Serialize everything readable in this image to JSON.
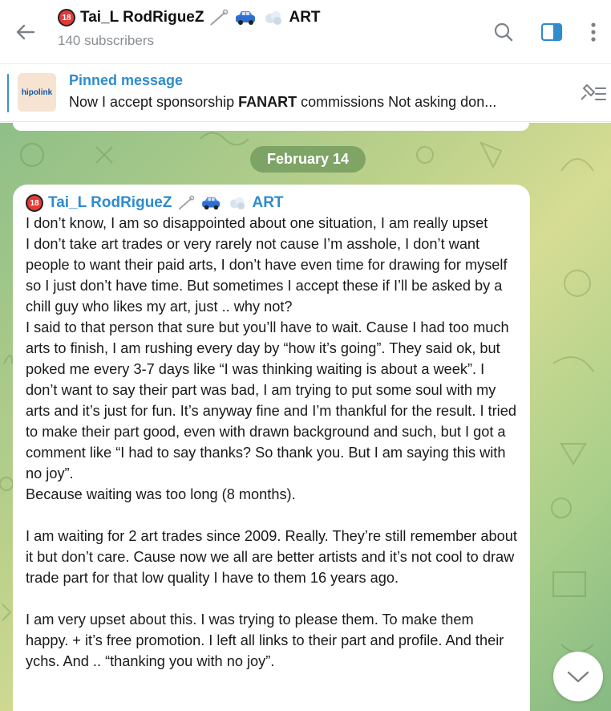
{
  "header": {
    "channel_name": "Tai_L RodRigueZ",
    "channel_suffix": "ART",
    "badge": "18",
    "subscribers": "140 subscribers"
  },
  "pinned": {
    "thumb_text": "hipolink",
    "title": "Pinned message",
    "text_before": "Now I accept sponsorship ",
    "text_bold": "FANART",
    "text_after": " commissions   Not asking  don..."
  },
  "chat": {
    "date": "February 14",
    "message": {
      "sender": "Tai_L RodRigueZ",
      "sender_suffix": "ART",
      "text": "I don’t know, I am so disappointed about one situation, I am really upset\nI don’t take art trades or very rarely not cause I’m asshole, I don’t want people to want their paid arts, I don’t have even time for drawing for myself so I just don’t have time. But sometimes I accept these if I’ll be asked by a chill guy who likes my art, just .. why not?\nI said to that person that sure but you’ll have to wait. Cause I had too much arts to finish, I am rushing every day by “how it’s going”. They said ok, but poked me every 3-7 days like “I was thinking waiting is about a week”. I don’t want to say their part was bad, I am trying to put some soul with my arts and it’s just for fun. It’s anyway fine and I’m thankful for the result. I tried to make their part good, even with drawn background and such, but I got a comment like “I had to say thanks? So thank you. But I am saying this with no joy”.\nBecause waiting was too long (8 months).\n\nI am waiting for 2 art trades since 2009. Really. They’re still remember about it but don’t care. Cause now we all are better artists and it’s not cool to draw trade part for that low quality I have to them 16 years ago.\n\nI am very upset about this. I was trying to please them. To make them happy. + it’s free promotion. I left all links to their part and profile. And their ychs. And .. “thanking you with no joy”."
    }
  },
  "colors": {
    "accent": "#2f8ccd",
    "badge_red": "#e53935"
  },
  "icons": [
    "back-arrow-icon",
    "search-icon",
    "sidebar-toggle-icon",
    "more-vertical-icon",
    "pin-list-icon",
    "chevron-down-icon",
    "safety-pin-icon",
    "car-icon",
    "smoke-puff-icon"
  ]
}
